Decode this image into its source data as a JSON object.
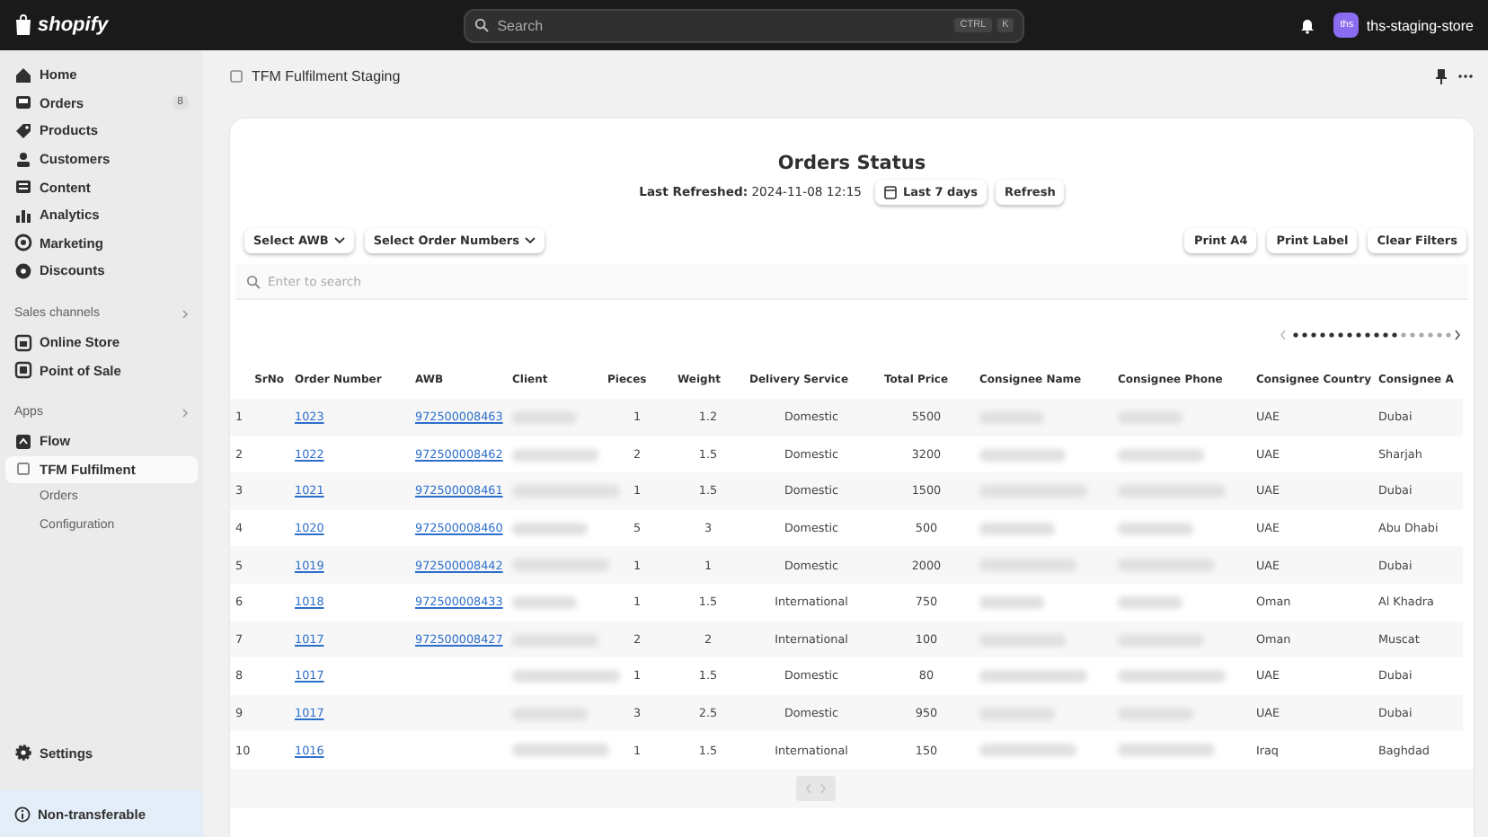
{
  "topbar": {
    "logo": "shopify",
    "search": {
      "placeholder": "Search",
      "keys": [
        "CTRL",
        "K"
      ]
    },
    "store": {
      "initials": "ths",
      "name": "ths-staging-store"
    }
  },
  "sidebar": {
    "groups": [
      {
        "items": [
          {
            "label": "Home",
            "selected": false
          },
          {
            "label": "Orders",
            "badge": "8",
            "selected": false
          },
          {
            "label": "Products",
            "selected": false
          },
          {
            "label": "Customers",
            "selected": false
          },
          {
            "label": "Content",
            "selected": false
          },
          {
            "label": "Analytics",
            "selected": false
          },
          {
            "label": "Marketing",
            "selected": false
          },
          {
            "label": "Discounts",
            "selected": false
          }
        ]
      },
      {
        "title": "Sales channels",
        "items": [
          {
            "label": "Online Store",
            "selected": false
          },
          {
            "label": "Point of Sale",
            "selected": false
          }
        ]
      },
      {
        "title": "Apps",
        "items": [
          {
            "label": "Flow",
            "selected": false
          },
          {
            "label": "TFM Fulfilment",
            "selected": true,
            "children": [
              {
                "label": "Orders",
                "selected": false
              },
              {
                "label": "Configuration",
                "selected": false
              }
            ]
          }
        ]
      }
    ],
    "settings": {
      "label": "Settings"
    },
    "footer": {
      "label": "Non-transferable"
    }
  },
  "page": {
    "title": "TFM Fulfilment Staging"
  },
  "card": {
    "title": "Orders Status",
    "refreshed": "**Last Refreshed:** 2024-11-08 12:15",
    "range_button": "Last 7 days",
    "refresh_button": "Refresh",
    "filters": [
      "Select AWB",
      "Select Order Numbers"
    ],
    "actions": [
      "Print A4",
      "Print Label",
      "Clear Filters"
    ],
    "search": {
      "placeholder": "Enter to search"
    }
  },
  "table": {
    "columns": [
      {
        "label": "SrNo",
        "kind": "text"
      },
      {
        "label": "Order Number",
        "kind": "link"
      },
      {
        "label": "AWB",
        "kind": "link"
      },
      {
        "label": "Client",
        "kind": "redacted"
      },
      {
        "label": "Pieces",
        "kind": "center"
      },
      {
        "label": "Weight",
        "kind": "center"
      },
      {
        "label": "Delivery Service",
        "kind": "center"
      },
      {
        "label": "Total Price",
        "kind": "center"
      },
      {
        "label": "Consignee Name",
        "kind": "redacted"
      },
      {
        "label": "Consignee Phone",
        "kind": "redacted"
      },
      {
        "label": "Consignee Country",
        "kind": "text"
      },
      {
        "label": "Consignee A",
        "kind": "text"
      }
    ],
    "rows": [
      [
        "1",
        "1023",
        "972500008463",
        null,
        "1",
        "1.2",
        "Domestic",
        "5500",
        null,
        null,
        "UAE",
        "Dubai"
      ],
      [
        "2",
        "1022",
        "972500008462",
        null,
        "2",
        "1.5",
        "Domestic",
        "3200",
        null,
        null,
        "UAE",
        "Sharjah"
      ],
      [
        "3",
        "1021",
        "972500008461",
        null,
        "1",
        "1.5",
        "Domestic",
        "1500",
        null,
        null,
        "UAE",
        "Dubai"
      ],
      [
        "4",
        "1020",
        "972500008460",
        null,
        "5",
        "3",
        "Domestic",
        "500",
        null,
        null,
        "UAE",
        "Abu Dhabi"
      ],
      [
        "5",
        "1019",
        "972500008442",
        null,
        "1",
        "1",
        "Domestic",
        "2000",
        null,
        null,
        "UAE",
        "Dubai"
      ],
      [
        "6",
        "1018",
        "972500008433",
        null,
        "1",
        "1.5",
        "International",
        "750",
        null,
        null,
        "Oman",
        "Al Khadra"
      ],
      [
        "7",
        "1017",
        "972500008427",
        null,
        "2",
        "2",
        "International",
        "100",
        null,
        null,
        "Oman",
        "Muscat"
      ],
      [
        "8",
        "1017",
        "",
        null,
        "1",
        "1.5",
        "Domestic",
        "80",
        null,
        null,
        "UAE",
        "Dubai"
      ],
      [
        "9",
        "1017",
        "",
        null,
        "3",
        "2.5",
        "Domestic",
        "950",
        null,
        null,
        "UAE",
        "Dubai"
      ],
      [
        "10",
        "1016",
        "",
        null,
        "1",
        "1.5",
        "International",
        "150",
        null,
        null,
        "Iraq",
        "Baghdad"
      ]
    ]
  }
}
